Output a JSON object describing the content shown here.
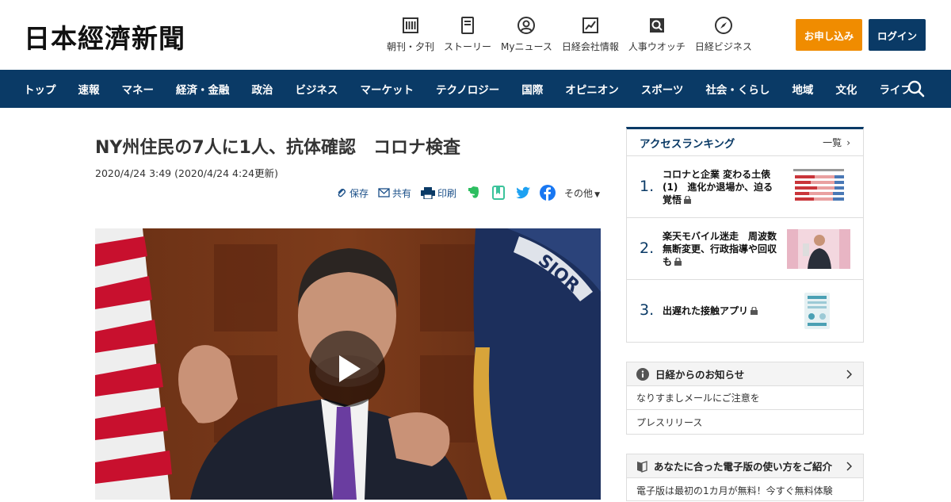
{
  "header": {
    "logo": "日本經濟新聞",
    "tools": [
      {
        "label": "朝刊・夕刊",
        "icon": "newspaper-icon"
      },
      {
        "label": "ストーリー",
        "icon": "story-icon"
      },
      {
        "label": "Myニュース",
        "icon": "user-icon"
      },
      {
        "label": "日経会社情報",
        "icon": "chart-icon"
      },
      {
        "label": "人事ウオッチ",
        "icon": "search-person-icon"
      },
      {
        "label": "日経ビジネス",
        "icon": "compass-icon"
      }
    ],
    "apply_label": "お申し込み",
    "login_label": "ログイン",
    "colors": {
      "apply": "#f08c00",
      "navy": "#0a3a66"
    }
  },
  "nav": {
    "items": [
      "トップ",
      "速報",
      "マネー",
      "経済・金融",
      "政治",
      "ビジネス",
      "マーケット",
      "テクノロジー",
      "国際",
      "オピニオン",
      "スポーツ",
      "社会・くらし",
      "地域",
      "文化",
      "ライフ"
    ],
    "search_icon": "search-icon"
  },
  "article": {
    "title": "NY州住民の7人に1人、抗体確認　コロナ検査",
    "date": "2020/4/24 3:49 (2020/4/24 4:24更新)",
    "share": {
      "save": "保存",
      "share": "共有",
      "print": "印刷",
      "more": "その他"
    }
  },
  "sidebar": {
    "ranking": {
      "title": "アクセスランキング",
      "more": "一覧",
      "items": [
        {
          "rank": "1.",
          "text": "コロナと企業 変わる土俵(1)　進化か退場か、迫る覚悟"
        },
        {
          "rank": "2.",
          "text": "楽天モバイル迷走　周波数無断変更、行政指導や回収も"
        },
        {
          "rank": "3.",
          "text": "出遅れた接触アプリ"
        }
      ]
    },
    "notice": {
      "title": "日経からのお知らせ",
      "items": [
        "なりすましメールにご注意を",
        "プレスリリース"
      ]
    },
    "guide": {
      "title": "あなたに合った電子版の使い方をご紹介",
      "items": [
        "電子版は最初の1カ月が無料！今すぐ無料体験"
      ]
    }
  }
}
